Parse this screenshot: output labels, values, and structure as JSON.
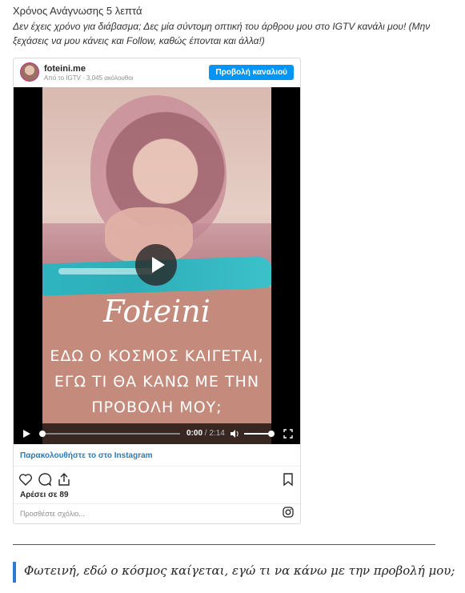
{
  "article": {
    "reading_time": "Χρόνος Ανάγνωσης 5 λεπτά",
    "intro": "Δεν έχεις χρόνο για διάβασμα; Δες μία σύντομη οπτική του άρθρου μου στο IGTV κανάλι μου! (Μην ξεχάσεις να μου κάνεις και Follow, καθώς έπονται και άλλα!)"
  },
  "embed": {
    "account": "foteini.me",
    "meta": "Από το IGTV · 3,045 ακόλουθοι",
    "view_channel": "Προβολή καναλιού",
    "poster": {
      "brand": "Foteini",
      "tagline": "ΕΔΩ Ο ΚΟΣΜΟΣ ΚΑΙΓΕΤΑΙ, ΕΓΩ ΤΙ ΘΑ ΚΑΝΩ ΜΕ ΤΗΝ ΠΡΟΒΟΛΗ ΜΟΥ;"
    },
    "player": {
      "current_time": "0:00",
      "duration": "/ 2:14",
      "progress": 0.0,
      "volume": 0.9
    },
    "watch_link": "Παρακολουθήστε το στο Instagram",
    "likes": "Αρέσει σε 89",
    "comment_placeholder": "Προσθέστε σχόλιο...",
    "icons": [
      "heart-icon",
      "comment-icon",
      "share-icon",
      "bookmark-icon",
      "instagram-icon",
      "play-icon",
      "volume-icon",
      "fullscreen-icon"
    ],
    "accent": "#0095f6"
  },
  "quote": "Φωτεινή, εδώ ο κόσμος καίγεται, εγώ τι να κάνω με την προβολή μου;"
}
